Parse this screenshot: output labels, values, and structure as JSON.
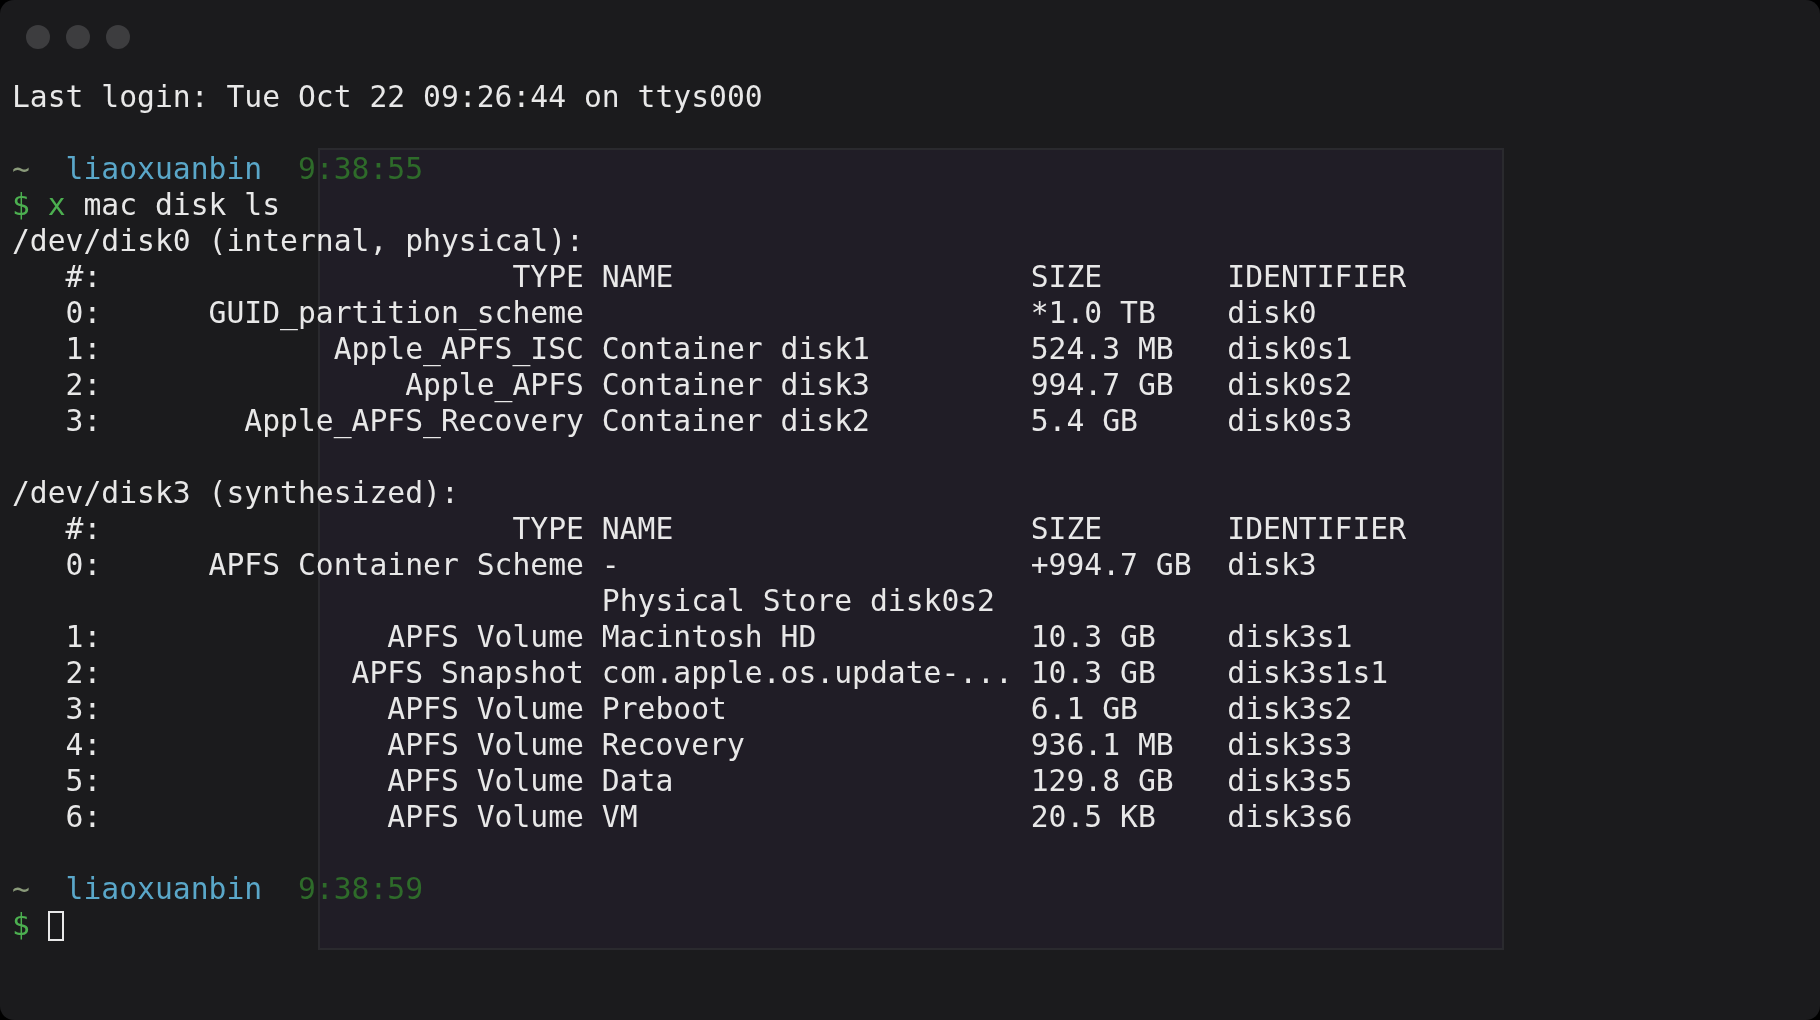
{
  "blocks": [
    {
      "kind": "text",
      "text": "Last login: Tue Oct 22 09:26:44 on ttys000"
    },
    {
      "kind": "prompt",
      "dir": "~",
      "user": "liaoxuanbin",
      "time": "9:38:55",
      "symbol": "$",
      "command": "x",
      "args": "mac disk ls",
      "cursor": false
    },
    {
      "kind": "disk",
      "title": "/dev/disk0 (internal, physical):",
      "columns": [
        "#:",
        "TYPE",
        "NAME",
        "SIZE",
        "IDENTIFIER"
      ],
      "rows": [
        {
          "index": "0:",
          "type": "GUID_partition_scheme",
          "name": "",
          "size": "*1.0 TB",
          "identifier": "disk0"
        },
        {
          "index": "1:",
          "type": "Apple_APFS_ISC",
          "name": "Container disk1",
          "size": "524.3 MB",
          "identifier": "disk0s1"
        },
        {
          "index": "2:",
          "type": "Apple_APFS",
          "name": "Container disk3",
          "size": "994.7 GB",
          "identifier": "disk0s2"
        },
        {
          "index": "3:",
          "type": "Apple_APFS_Recovery",
          "name": "Container disk2",
          "size": "5.4 GB",
          "identifier": "disk0s3"
        }
      ]
    },
    {
      "kind": "disk",
      "title": "/dev/disk3 (synthesized):",
      "columns": [
        "#:",
        "TYPE",
        "NAME",
        "SIZE",
        "IDENTIFIER"
      ],
      "rows": [
        {
          "index": "0:",
          "type": "APFS Container Scheme",
          "name": "-",
          "size": "+994.7 GB",
          "identifier": "disk3"
        },
        {
          "name": "Physical Store disk0s2"
        },
        {
          "index": "1:",
          "type": "APFS Volume",
          "name": "Macintosh HD",
          "size": "10.3 GB",
          "identifier": "disk3s1"
        },
        {
          "index": "2:",
          "type": "APFS Snapshot",
          "name": "com.apple.os.update-...",
          "size": "10.3 GB",
          "identifier": "disk3s1s1"
        },
        {
          "index": "3:",
          "type": "APFS Volume",
          "name": "Preboot",
          "size": "6.1 GB",
          "identifier": "disk3s2"
        },
        {
          "index": "4:",
          "type": "APFS Volume",
          "name": "Recovery",
          "size": "936.1 MB",
          "identifier": "disk3s3"
        },
        {
          "index": "5:",
          "type": "APFS Volume",
          "name": "Data",
          "size": "129.8 GB",
          "identifier": "disk3s5"
        },
        {
          "index": "6:",
          "type": "APFS Volume",
          "name": "VM",
          "size": "20.5 KB",
          "identifier": "disk3s6"
        }
      ]
    },
    {
      "kind": "prompt",
      "dir": "~",
      "user": "liaoxuanbin",
      "time": "9:38:59",
      "symbol": "$",
      "cursor": true
    }
  ]
}
